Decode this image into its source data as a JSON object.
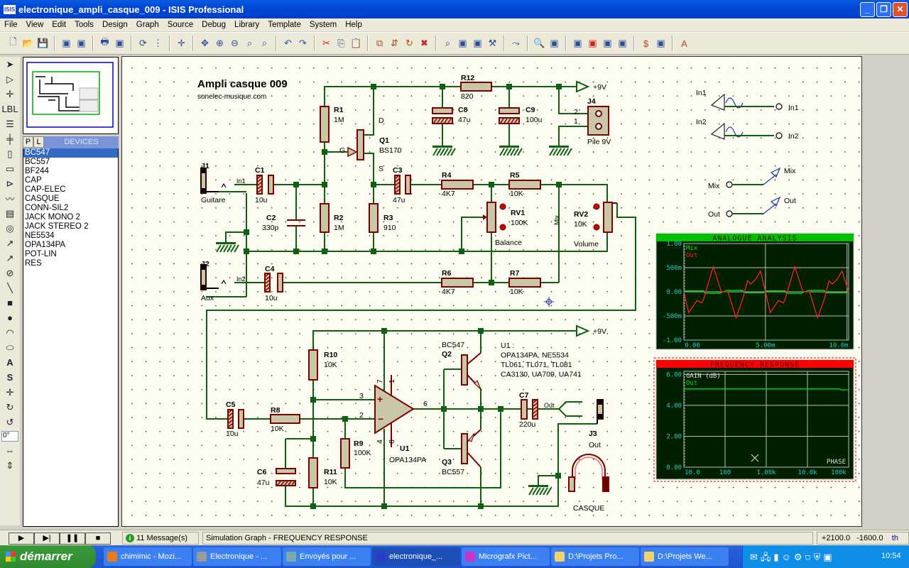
{
  "window": {
    "title": "electronique_ampli_casque_009 - ISIS Professional",
    "app_icon": "ISIS",
    "controls": [
      "minimize",
      "maximize",
      "close"
    ]
  },
  "menu": [
    "File",
    "View",
    "Edit",
    "Tools",
    "Design",
    "Graph",
    "Source",
    "Debug",
    "Library",
    "Template",
    "System",
    "Help"
  ],
  "toolbar": [
    [
      "new-icon",
      "open-icon",
      "save-icon"
    ],
    [
      "import-section-icon",
      "export-section-icon"
    ],
    [
      "print-icon",
      "set-area-icon"
    ],
    [
      "redraw-icon",
      "grid-toggle-icon"
    ],
    [
      "origin-icon"
    ],
    [
      "pan-icon",
      "zoom-in-icon",
      "zoom-out-icon",
      "zoom-all-icon",
      "zoom-area-icon"
    ],
    [
      "undo-icon",
      "redo-icon"
    ],
    [
      "cut-icon",
      "copy-icon",
      "paste-icon"
    ],
    [
      "block-copy-icon",
      "block-move-icon",
      "block-rotate-icon",
      "block-delete-icon"
    ],
    [
      "pick-device-icon",
      "make-device-icon",
      "packaging-tool-icon",
      "decompose-icon"
    ],
    [
      "wire-autorouter-icon"
    ],
    [
      "search-tag-icon",
      "property-assignment-icon"
    ],
    [
      "new-sheet-icon",
      "remove-sheet-icon",
      "goto-sheet-icon",
      "export-sheet-icon"
    ],
    [
      "bill-of-materials-icon",
      "electrical-rule-check-icon"
    ],
    [
      "netlist-to-ares-icon"
    ]
  ],
  "left_tools": [
    "selection-mode-icon",
    "component-mode-icon",
    "junction-dot-icon",
    "wire-label-icon",
    "text-script-icon",
    "bus-icon",
    "subcircuit-icon",
    "terminals-icon",
    "device-pins-icon",
    "graph-icon",
    "tape-recorder-icon",
    "generator-icon",
    "voltage-probe-icon",
    "current-probe-icon",
    "virtual-instruments-icon",
    "line-icon",
    "box-icon",
    "circle-icon",
    "arc-icon",
    "path-icon",
    "text-icon",
    "symbol-icon",
    "marker-icon",
    "rotate-cw-icon",
    "rotate-ccw-icon",
    "mirror-x-icon",
    "mirror-y-icon"
  ],
  "rotation_angle": "0°",
  "devices": {
    "tab_p": "P",
    "tab_l": "L",
    "title": "DEVICES",
    "selected": "BC547",
    "items": [
      "BC547",
      "BC557",
      "BF244",
      "CAP",
      "CAP-ELEC",
      "CASQUE",
      "CONN-SIL2",
      "JACK MONO 2",
      "JACK STEREO 2",
      "NE5534",
      "OPA134PA",
      "POT-LIN",
      "RES"
    ]
  },
  "schematic": {
    "title": "Ampli casque 009",
    "subtitle": "sonelec-musique.com",
    "colors": {
      "wire": "#0f5f14",
      "component": "#800000",
      "body": "#c8c8a8"
    },
    "c": {
      "R1": [
        "R1",
        "1M"
      ],
      "R2": [
        "R2",
        "1M"
      ],
      "R3": [
        "R3",
        "910"
      ],
      "R4": [
        "R4",
        "4K7"
      ],
      "R5": [
        "R5",
        "10K"
      ],
      "R6": [
        "R6",
        "4K7"
      ],
      "R7": [
        "R7",
        "10K"
      ],
      "R8": [
        "R8",
        "10K"
      ],
      "R9": [
        "R9",
        "100K"
      ],
      "R10": [
        "R10",
        "10K"
      ],
      "R11": [
        "R11",
        "10K"
      ],
      "R12": [
        "R12",
        "820"
      ],
      "C1": [
        "C1",
        "10u"
      ],
      "C2": [
        "C2",
        "330p"
      ],
      "C3": [
        "C3",
        "47u"
      ],
      "C4": [
        "C4",
        "10u"
      ],
      "C5": [
        "C5",
        "10u"
      ],
      "C6": [
        "C6",
        "47u"
      ],
      "C7": [
        "C7",
        "220u"
      ],
      "C8": [
        "C8",
        "47u"
      ],
      "C9": [
        "C9",
        "100u"
      ],
      "Q1": [
        "Q1",
        "BS170"
      ],
      "Q2": [
        "Q2",
        "BC547"
      ],
      "Q3": [
        "Q3",
        "BC557"
      ],
      "U1": [
        "U1",
        "OPA134PA"
      ],
      "RV1": [
        "RV1",
        "100K",
        "Balance"
      ],
      "RV2": [
        "RV2",
        "10K",
        "Volume"
      ],
      "J1": [
        "J1",
        "Guitare"
      ],
      "J2": [
        "J2",
        "Aux"
      ],
      "J3": [
        "J3",
        "Out"
      ],
      "J4": [
        "J4",
        "Pile 9V"
      ],
      "CASQUE": [
        "CASQUE"
      ]
    },
    "nets": {
      "vcc": "+9V",
      "in1": "In1",
      "in2": "In2",
      "mix": "Mix",
      "out": "Out"
    },
    "pins": {
      "d": "D",
      "g": "G",
      "s": "S",
      "j4_2": "2",
      "j4_1": "1",
      "u1_3": "3",
      "u1_2": "2",
      "u1_6": "6",
      "u1_7": "7",
      "u1_1": "1",
      "u1_4": "4",
      "u1_8": "8",
      "plus": "+",
      "minus": "−"
    },
    "u1_note": [
      "U1 :",
      "OPA134PA, NE5534",
      "TL061, TL071, TL081",
      "CA3130, UA709, UA741"
    ],
    "generators": {
      "in1_src": "In1",
      "in1_dst": "In1",
      "in2_src": "In2",
      "in2_dst": "In2",
      "mix_src": "Mix",
      "mix_dst": "Mix",
      "out_src": "Out",
      "out_dst": "Out"
    }
  },
  "chart_data": [
    {
      "type": "line",
      "title": "ANALOGUE ANALYSIS",
      "title_color": "#00c000",
      "background": "#002000",
      "xlim": [
        0,
        0.0101
      ],
      "ylim": [
        -1.0,
        1.0
      ],
      "grid": true,
      "legend": "top-left",
      "xticks": [
        "0.00",
        "5.00m",
        "10.0m"
      ],
      "xtick_values": [
        0,
        0.005,
        0.01
      ],
      "yticks": [
        "1.00",
        "500m",
        "0.00",
        "-500m",
        "-1.00"
      ],
      "ytick_values": [
        1,
        0.5,
        0,
        -0.5,
        -1
      ],
      "series": [
        {
          "name": "Mix",
          "color": "#00e000",
          "x": [
            0,
            0.0012,
            0.0013,
            0.0022,
            0.0024,
            0.0027,
            0.0036,
            0.0037,
            0.0049,
            0.005,
            0.0062,
            0.0063,
            0.0072,
            0.0074,
            0.0077,
            0.0086,
            0.0087,
            0.0099,
            0.0101
          ],
          "y": [
            0.02,
            0.02,
            -0.03,
            -0.03,
            0,
            0.03,
            0.03,
            -0.02,
            -0.02,
            0.02,
            0.02,
            -0.03,
            -0.03,
            0,
            0.03,
            0.03,
            -0.02,
            -0.02,
            0
          ]
        },
        {
          "name": "Out",
          "color": "#ff2020",
          "x": [
            0,
            0.0003,
            0.0008,
            0.0011,
            0.0012,
            0.0018,
            0.0023,
            0.0027,
            0.0032,
            0.0036,
            0.0039,
            0.0041,
            0.0044,
            0.0047,
            0.005,
            0.0053,
            0.0058,
            0.0061,
            0.0062,
            0.0068,
            0.0073,
            0.0077,
            0.0082,
            0.0086,
            0.0089,
            0.0091,
            0.0094,
            0.0097,
            0.0101
          ],
          "y": [
            0,
            -0.43,
            -0.18,
            -0.23,
            -0.16,
            0.52,
            0,
            0,
            -0.54,
            -0.16,
            0.23,
            0.16,
            0.26,
            0.43,
            0,
            -0.43,
            -0.18,
            -0.23,
            -0.16,
            0.52,
            0,
            0,
            -0.54,
            -0.16,
            0.23,
            0.16,
            0.26,
            0.43,
            0
          ]
        }
      ]
    },
    {
      "type": "line",
      "title": "FREQUENCY RESPONSE",
      "title_color": "#ff0000",
      "background": "#002000",
      "ylabel": "GAIN (dB)",
      "right_label": "PHASE",
      "xscale": "log",
      "xlim": [
        10,
        100000
      ],
      "ylim": [
        0,
        6.2
      ],
      "grid": true,
      "legend": "top-left",
      "xticks": [
        "10.0",
        "100",
        "1.00k",
        "10.0k",
        "100k"
      ],
      "xtick_values": [
        10,
        100,
        1000,
        10000,
        100000
      ],
      "yticks": [
        "6.00",
        "4.00",
        "2.00",
        "0.00"
      ],
      "ytick_values": [
        6,
        4,
        2,
        0
      ],
      "series": [
        {
          "name": "Out",
          "color": "#00e000",
          "x": [
            10,
            100,
            1000,
            10000,
            60000,
            65000,
            100000
          ],
          "y": [
            5.06,
            5.06,
            5.06,
            5.06,
            5.06,
            5.0,
            5.0
          ]
        }
      ]
    }
  ],
  "status": {
    "messages": "11 Message(s)",
    "text": "Simulation Graph - FREQUENCY RESPONSE",
    "x": "+2100.0",
    "y": "-1600.0",
    "unit": "th",
    "controls": [
      "play",
      "step",
      "pause",
      "stop"
    ]
  },
  "taskbar": {
    "start": "démarrer",
    "clock": "10:54",
    "tasks": [
      {
        "label": "chimimic - Mozi...",
        "icon": "#e87b1e"
      },
      {
        "label": "Electronique - ...",
        "icon": "#999"
      },
      {
        "label": "Envoyés pour ...",
        "icon": "#7aa"
      },
      {
        "label": "electronique_...",
        "icon": "#2b3dc8",
        "active": true
      },
      {
        "label": "Micrografx Pict...",
        "icon": "#c3c"
      },
      {
        "label": "D:\\Projets Pro...",
        "icon": "#f5d36b"
      },
      {
        "label": "D:\\Projets We...",
        "icon": "#f5d36b"
      }
    ]
  }
}
